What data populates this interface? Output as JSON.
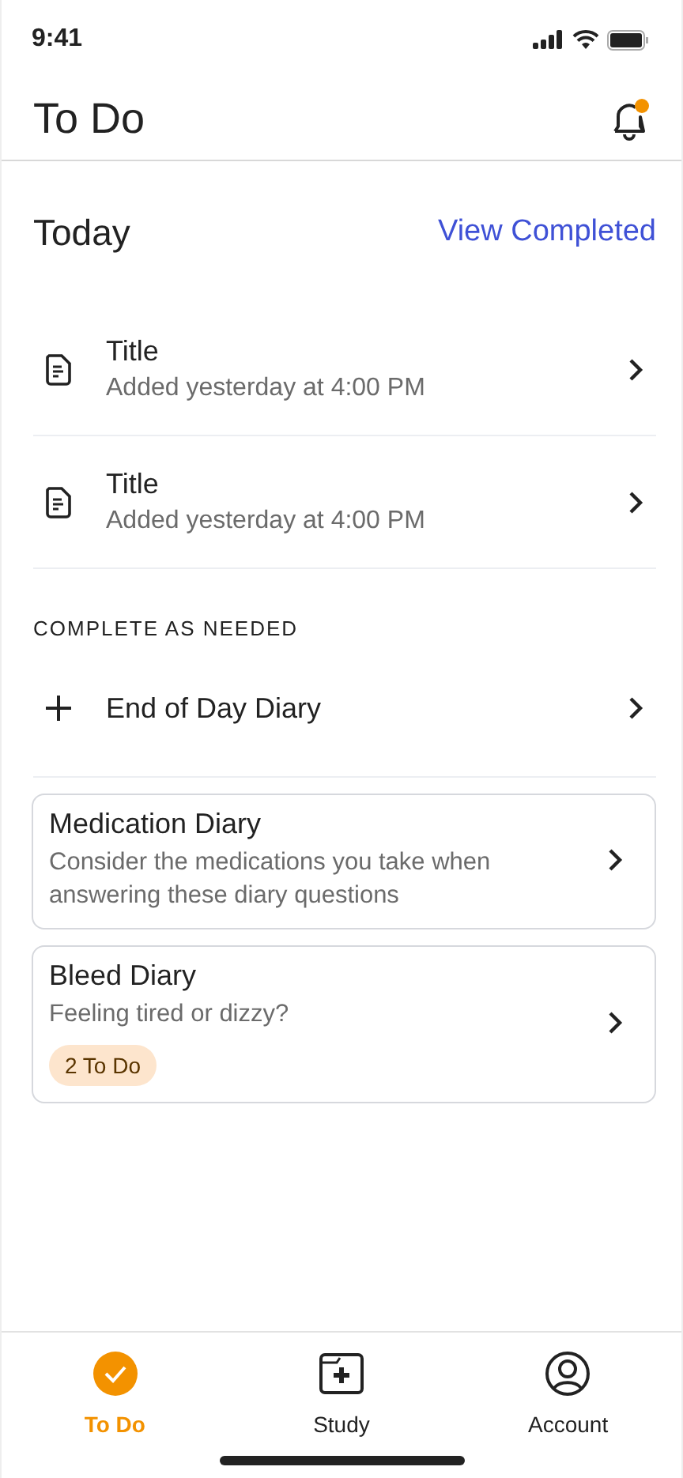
{
  "status_bar": {
    "time": "9:41"
  },
  "header": {
    "title": "To Do",
    "has_notification": true
  },
  "today": {
    "heading": "Today",
    "link": "View Completed",
    "items": [
      {
        "title": "Title",
        "subtitle": "Added yesterday at 4:00 PM"
      },
      {
        "title": "Title",
        "subtitle": "Added yesterday at 4:00 PM"
      }
    ]
  },
  "as_needed": {
    "heading": "COMPLETE AS NEEDED",
    "add_item": "End of Day Diary",
    "cards": [
      {
        "title": "Medication Diary",
        "description": "Consider the medications you take when answering these diary questions"
      },
      {
        "title": "Bleed Diary",
        "description": "Feeling tired or dizzy?",
        "badge": "2 To Do"
      }
    ]
  },
  "tabs": [
    {
      "label": "To Do",
      "kind": "check",
      "selected": true
    },
    {
      "label": "Study",
      "kind": "folder",
      "selected": false
    },
    {
      "label": "Account",
      "kind": "person",
      "selected": false
    }
  ]
}
